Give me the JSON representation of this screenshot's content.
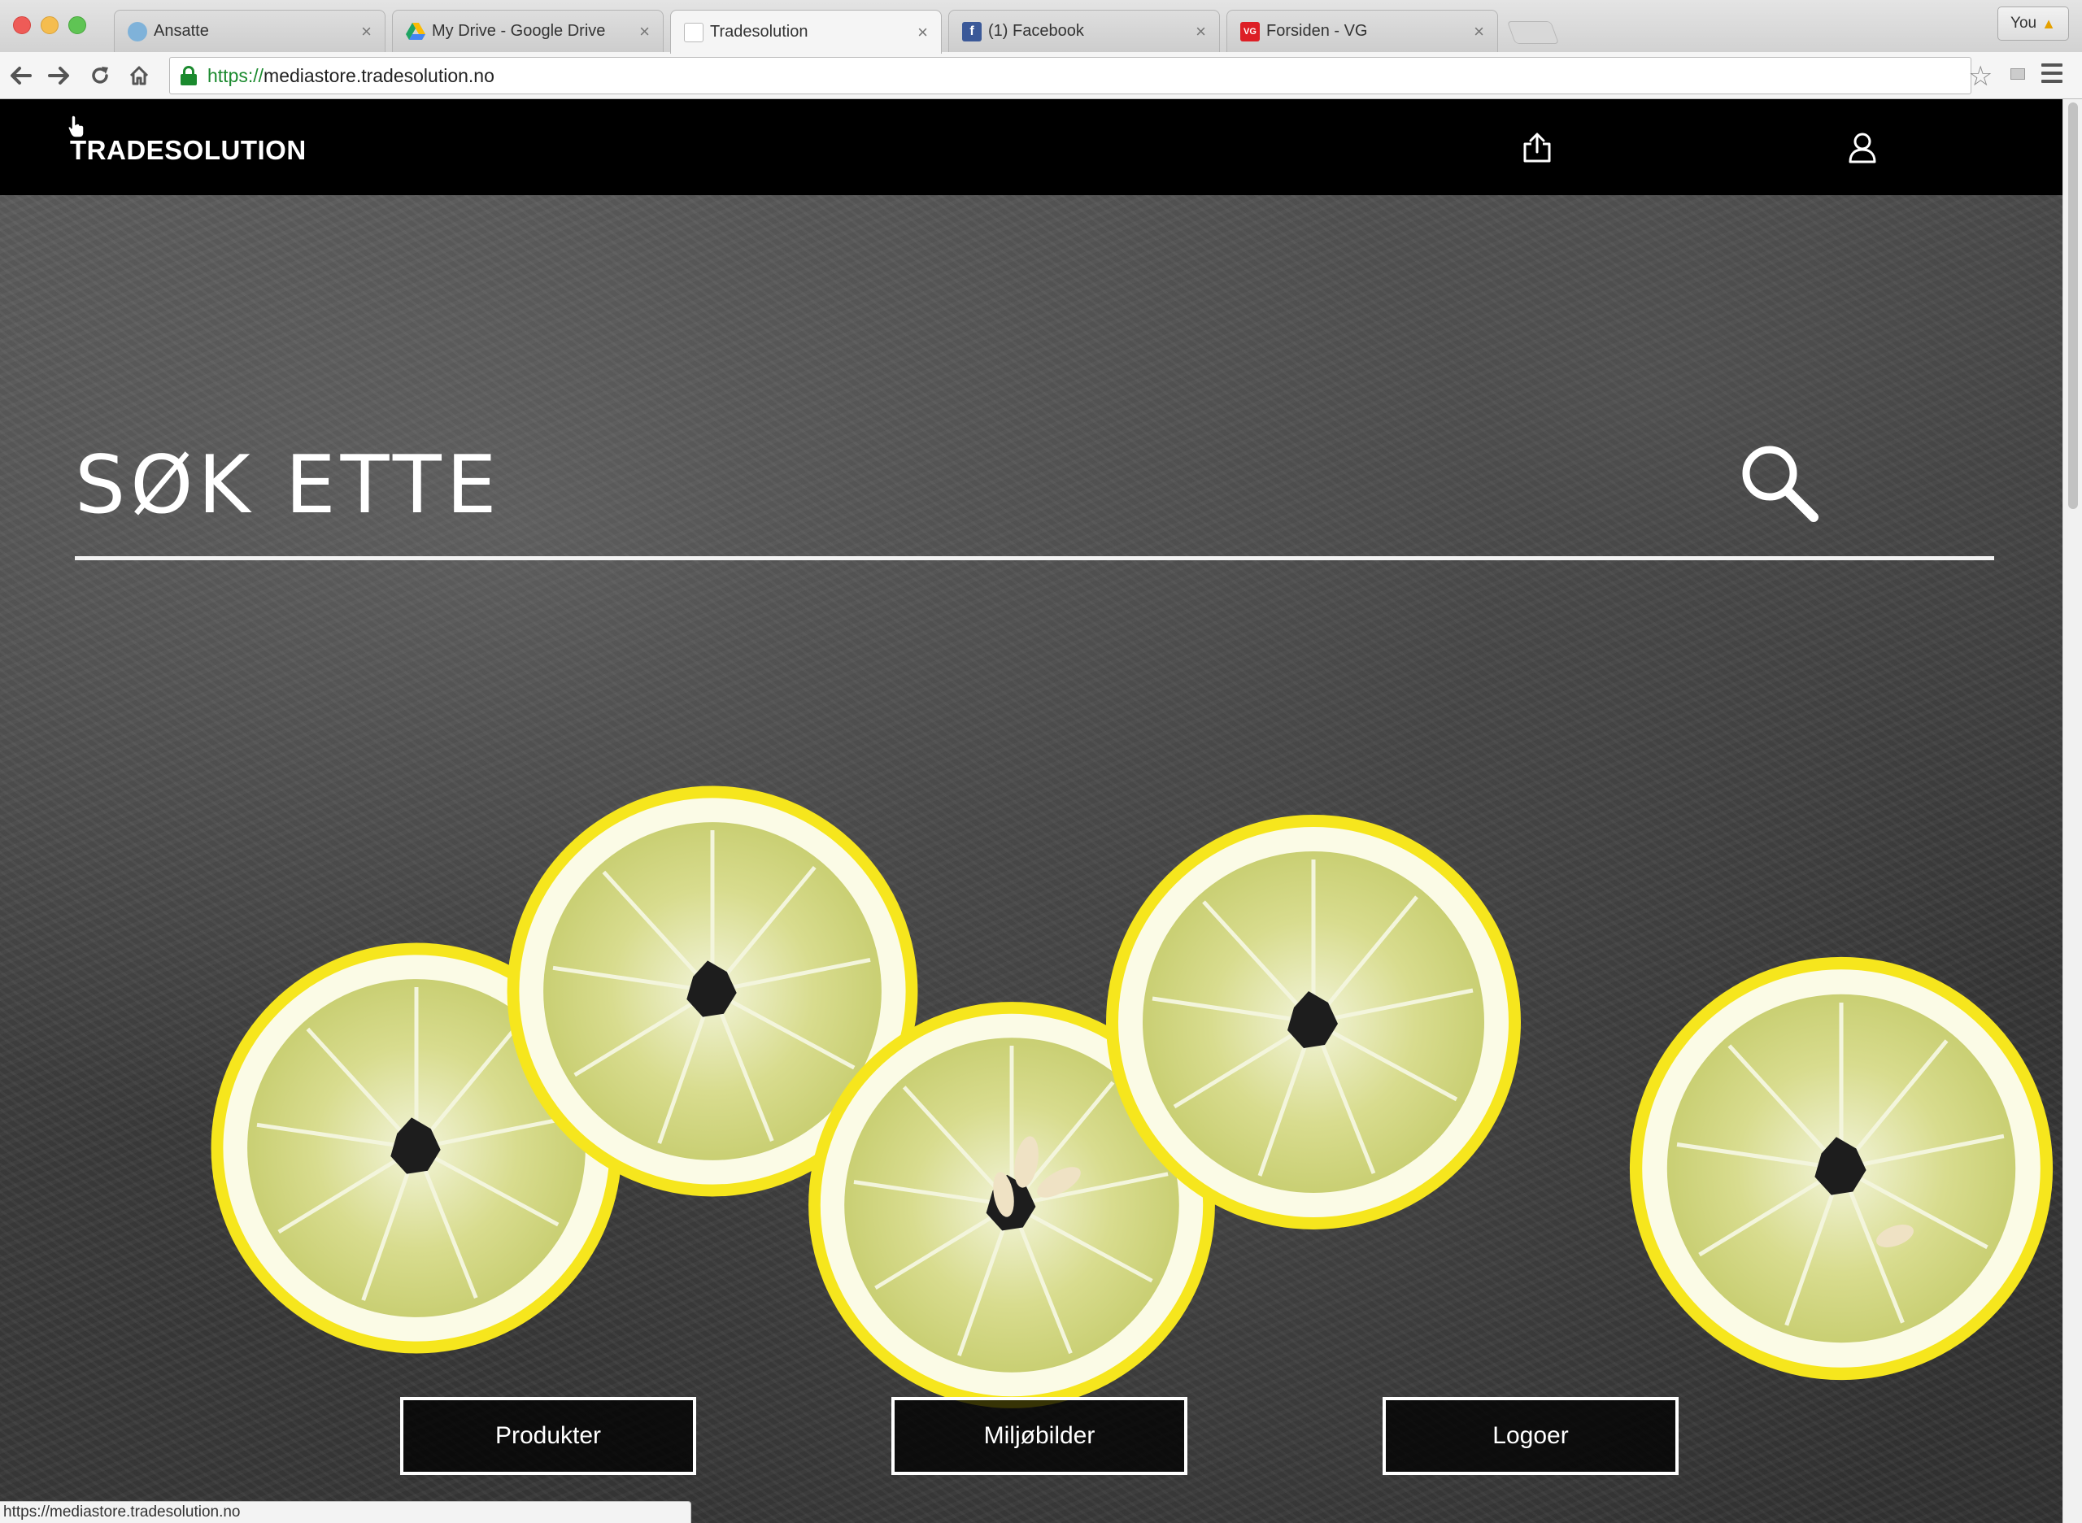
{
  "browser": {
    "tabs": [
      {
        "title": "Ansatte",
        "icon": "ansatte-favicon",
        "active": false
      },
      {
        "title": "My Drive - Google Drive",
        "icon": "google-drive-icon",
        "active": false
      },
      {
        "title": "Tradesolution",
        "icon": "page-favicon",
        "active": true
      },
      {
        "title": "(1) Facebook",
        "icon": "facebook-icon",
        "active": false
      },
      {
        "title": "Forsiden - VG",
        "icon": "vg-icon",
        "active": false
      }
    ],
    "profile_label": "You",
    "address": {
      "scheme": "https://",
      "host": "mediastore.tradesolution.no"
    },
    "status_url": "https://mediastore.tradesolution.no"
  },
  "site": {
    "logo_text": "TRADESOLUTION",
    "search_placeholder": "SØK ETTE",
    "buttons": [
      {
        "label": "Produkter"
      },
      {
        "label": "Miljøbilder"
      },
      {
        "label": "Logoer"
      }
    ]
  },
  "colors": {
    "accent_green": "#1b8a2e",
    "header_bg": "#000000",
    "lemon_rind": "#f6e61d",
    "lemon_pith": "#fbfbe6",
    "lemon_flesh": "#d2d889"
  }
}
